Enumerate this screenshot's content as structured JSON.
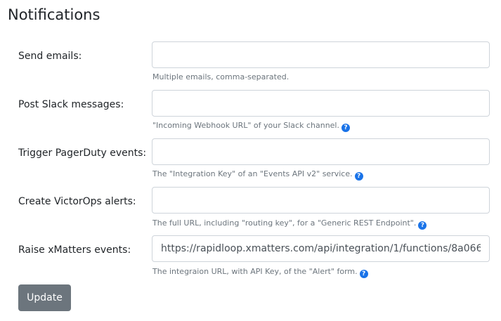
{
  "page": {
    "title": "Notifications"
  },
  "fields": [
    {
      "label": "Send emails:",
      "value": "",
      "help": "Multiple emails, comma-separated.",
      "has_help_icon": false
    },
    {
      "label": "Post Slack messages:",
      "value": "",
      "help": "\"Incoming Webhook URL\" of your Slack channel.",
      "has_help_icon": true
    },
    {
      "label": "Trigger PagerDuty events:",
      "value": "",
      "help": "The \"Integration Key\" of an \"Events API v2\" service.",
      "has_help_icon": true
    },
    {
      "label": "Create VictorOps alerts:",
      "value": "",
      "help": "The full URL, including \"routing key\", for a \"Generic REST Endpoint\".",
      "has_help_icon": true
    },
    {
      "label": "Raise xMatters events:",
      "value": "https://rapidloop.xmatters.com/api/integration/1/functions/8a066(",
      "help": "The integraion URL, with API Key, of the \"Alert\" form.",
      "has_help_icon": true
    }
  ],
  "help_icon_glyph": "?",
  "colors": {
    "help_icon": "#1a73e8",
    "button_bg": "#6c757d"
  },
  "actions": {
    "update_label": "Update"
  }
}
